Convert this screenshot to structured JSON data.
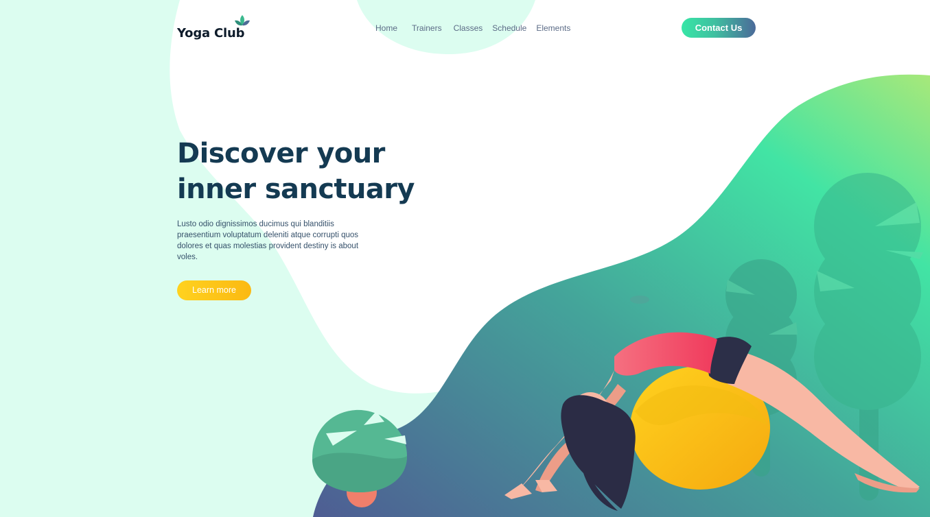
{
  "brand": {
    "name": "Yoga Club",
    "icon": "lotus-icon"
  },
  "nav": {
    "items": [
      {
        "label": "Home"
      },
      {
        "label": "Trainers"
      },
      {
        "label": "Classes"
      },
      {
        "label": "Schedule"
      },
      {
        "label": "Elements"
      }
    ]
  },
  "header": {
    "contact_label": "Contact Us"
  },
  "hero": {
    "title_line1": "Discover your",
    "title_line2": "inner sanctuary",
    "description": "Lusto odio dignissimos ducimus qui blanditiis praesentium voluptatum deleniti atque corrupti quos dolores et quas molestias provident destiny is about voles.",
    "cta_label": "Learn more"
  },
  "colors": {
    "mint_background": "#dcfdf0",
    "green_accent": "#3fe0a0",
    "navy_text": "#143a52",
    "yellow_button": "#fbc515",
    "teal_wave": "#4a9a9a"
  }
}
